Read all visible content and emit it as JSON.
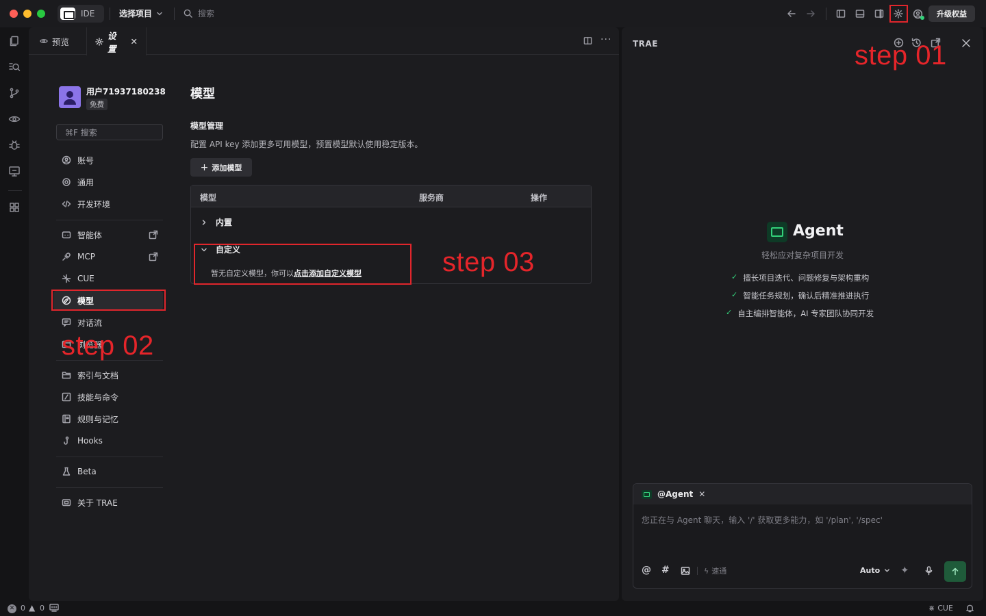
{
  "titlebar": {
    "app_label": "IDE",
    "project_selector": "选择项目",
    "search_placeholder": "搜索",
    "upgrade_label": "升级权益"
  },
  "tabs": [
    {
      "label": "预览",
      "icon": "eye-icon"
    },
    {
      "label": "设置",
      "icon": "gear-icon",
      "active": true
    }
  ],
  "user": {
    "name": "用户71937180238",
    "plan": "免费"
  },
  "settings_search_placeholder": "⌘F 搜索",
  "nav": {
    "items": [
      {
        "label": "账号",
        "icon": "account-icon"
      },
      {
        "label": "通用",
        "icon": "gear-icon"
      },
      {
        "label": "开发环境",
        "icon": "code-icon"
      },
      {
        "label": "智能体",
        "icon": "agent-icon"
      },
      {
        "label": "MCP",
        "icon": "plug-icon"
      },
      {
        "label": "CUE",
        "icon": "cue-icon"
      },
      {
        "label": "模型",
        "icon": "model-icon",
        "active": true
      },
      {
        "label": "对话流",
        "icon": "chat-icon"
      },
      {
        "label": "浏览器",
        "icon": "browser-icon"
      },
      {
        "label": "索引与文档",
        "icon": "folder-icon"
      },
      {
        "label": "技能与命令",
        "icon": "slash-icon"
      },
      {
        "label": "规则与记忆",
        "icon": "book-icon"
      },
      {
        "label": "Hooks",
        "icon": "hook-icon"
      },
      {
        "label": "Beta",
        "icon": "flask-icon"
      },
      {
        "label": "关于 TRAE",
        "icon": "info-icon"
      }
    ]
  },
  "content": {
    "title": "模型",
    "section_title": "模型管理",
    "description": "配置 API key 添加更多可用模型，预置模型默认使用稳定版本。",
    "add_button": "添加模型",
    "table": {
      "headers": [
        "模型",
        "服务商",
        "操作"
      ],
      "groups": [
        {
          "label": "内置",
          "expanded": false
        },
        {
          "label": "自定义",
          "expanded": true
        }
      ],
      "empty_prefix": "暂无自定义模型，你可以",
      "empty_link": "点击添加自定义模型"
    }
  },
  "annotations": {
    "step1": "step 01",
    "step2": "step 02",
    "step3": "step 03",
    "color": "#e0262c"
  },
  "agent_panel": {
    "brand": "TRAE",
    "title": "Agent",
    "subtitle": "轻松应对复杂项目开发",
    "features": [
      "擅长项目迭代、问题修复与架构重构",
      "智能任务规划，确认后精准推进执行",
      "自主编排智能体，AI 专家团队协同开发"
    ],
    "composer": {
      "agent_tag": "@Agent",
      "placeholder": "您正在与 Agent 聊天，输入 '/' 获取更多能力，如 '/plan', '/spec'",
      "speed_label": "速通",
      "mode": "Auto"
    }
  },
  "statusbar": {
    "errors": "0",
    "warnings": "0",
    "cue": "CUE"
  },
  "colors": {
    "accent_green": "#33d17a",
    "annotation_red": "#e0262c"
  }
}
